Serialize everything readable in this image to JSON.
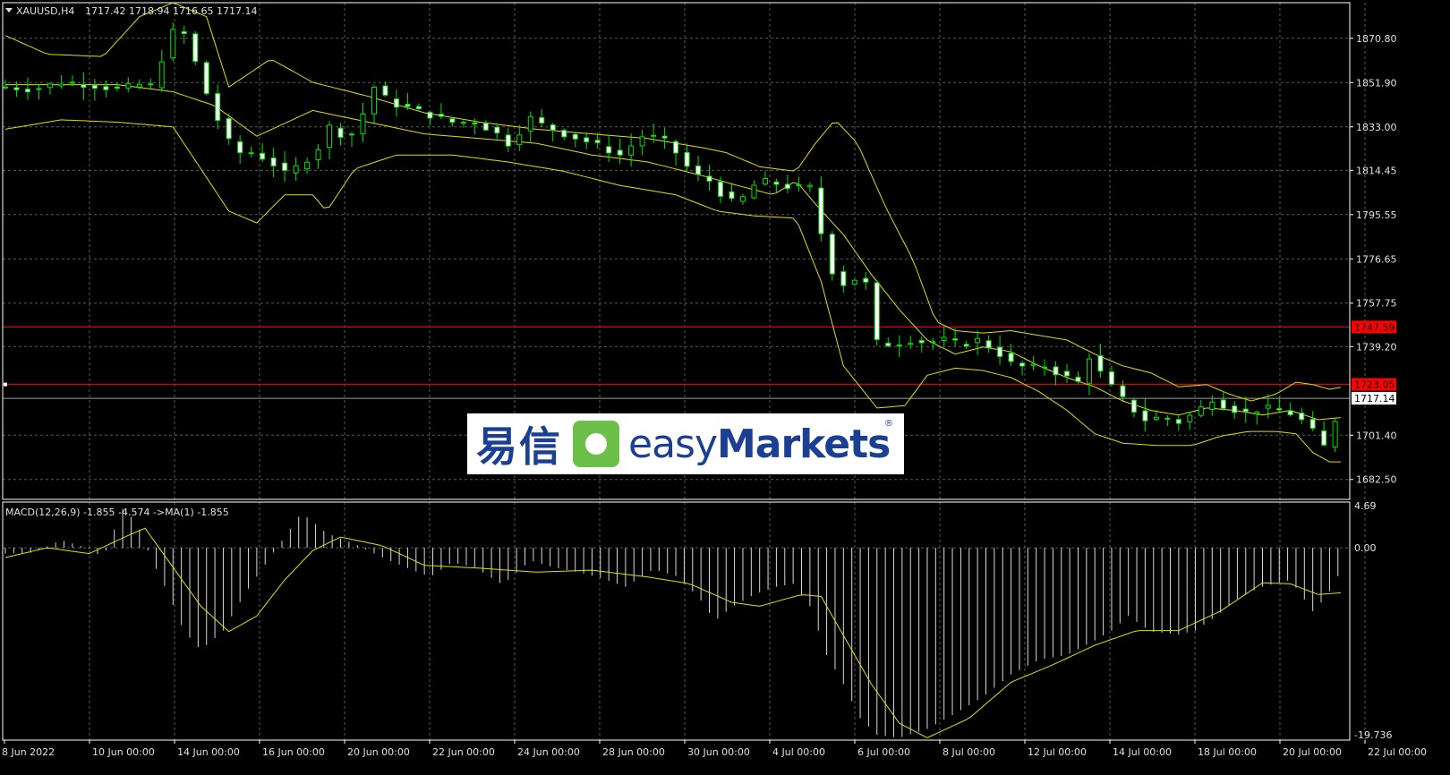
{
  "header": {
    "symbol": "XAUUSD,H4",
    "ohlc": "1717.42 1718.94 1716.65 1717.14"
  },
  "macd_label": "MACD(12,26,9) -1.855 -4.574  ->MA(1) -1.855",
  "logo": {
    "cn": "易信",
    "en_light": "easy",
    "en_bold": "Markets",
    "reg": "®"
  },
  "colors": {
    "bg": "#000000",
    "grid": "#5a5a5a",
    "candle": "#00e000",
    "band": "#e0e000",
    "macd_hist": "#d8d8d8",
    "signal": "#e0e000",
    "hline": "#ff0000",
    "price_line": "#a0a0a0"
  },
  "chart_data": [
    {
      "type": "candlestick",
      "title": "XAUUSD,H4",
      "ylim": [
        1674.0,
        1886.0
      ],
      "y_ticks": [
        1870.8,
        1851.9,
        1833.0,
        1814.45,
        1795.55,
        1776.65,
        1757.75,
        1739.2,
        1701.4,
        1682.5
      ],
      "x_ticks": [
        "8 Jun 2022",
        "10 Jun 00:00",
        "14 Jun 00:00",
        "16 Jun 00:00",
        "20 Jun 00:00",
        "22 Jun 00:00",
        "24 Jun 00:00",
        "28 Jun 00:00",
        "30 Jun 00:00",
        "4 Jul 00:00",
        "6 Jul 00:00",
        "8 Jul 00:00",
        "12 Jul 00:00",
        "14 Jul 00:00",
        "18 Jul 00:00",
        "20 Jul 00:00",
        "22 Jul 00:00"
      ],
      "hlines": [
        {
          "value": 1747.59,
          "label": "1747.59"
        },
        {
          "value": 1723.05,
          "label": "1723.05"
        }
      ],
      "current_price": {
        "value": 1717.14,
        "label": "1717.14"
      },
      "close_path": [
        [
          0,
          1850
        ],
        [
          10,
          1849
        ],
        [
          20,
          1852
        ],
        [
          30,
          1851
        ],
        [
          40,
          1849
        ],
        [
          48,
          1851
        ],
        [
          53,
          1850
        ],
        [
          58,
          1870
        ],
        [
          62,
          1877
        ],
        [
          66,
          1868
        ],
        [
          70,
          1853
        ],
        [
          76,
          1836
        ],
        [
          82,
          1822
        ],
        [
          88,
          1822
        ],
        [
          94,
          1819
        ],
        [
          100,
          1813
        ],
        [
          106,
          1817
        ],
        [
          112,
          1824
        ],
        [
          116,
          1833
        ],
        [
          120,
          1830
        ],
        [
          125,
          1830
        ],
        [
          132,
          1850
        ],
        [
          138,
          1843
        ],
        [
          145,
          1841
        ],
        [
          152,
          1838
        ],
        [
          160,
          1835
        ],
        [
          168,
          1835
        ],
        [
          175,
          1831
        ],
        [
          182,
          1824
        ],
        [
          186,
          1838
        ],
        [
          192,
          1834
        ],
        [
          200,
          1830
        ],
        [
          210,
          1826
        ],
        [
          220,
          1821
        ],
        [
          228,
          1829
        ],
        [
          235,
          1828
        ],
        [
          240,
          1822
        ],
        [
          246,
          1813
        ],
        [
          252,
          1810
        ],
        [
          258,
          1802
        ],
        [
          262,
          1800
        ],
        [
          268,
          1808
        ],
        [
          273,
          1810
        ],
        [
          278,
          1808
        ],
        [
          282,
          1807
        ],
        [
          288,
          1807
        ],
        [
          294,
          1778
        ],
        [
          298,
          1765
        ],
        [
          304,
          1768
        ],
        [
          308,
          1766
        ],
        [
          312,
          1741
        ],
        [
          318,
          1740
        ],
        [
          324,
          1742
        ],
        [
          330,
          1741
        ],
        [
          336,
          1742
        ],
        [
          342,
          1740
        ],
        [
          348,
          1742
        ],
        [
          354,
          1738
        ],
        [
          360,
          1732
        ],
        [
          366,
          1730
        ],
        [
          372,
          1731
        ],
        [
          378,
          1727
        ],
        [
          384,
          1724
        ],
        [
          388,
          1735
        ],
        [
          392,
          1728
        ],
        [
          396,
          1722
        ],
        [
          402,
          1714
        ],
        [
          408,
          1708
        ],
        [
          414,
          1709
        ],
        [
          420,
          1707
        ],
        [
          426,
          1711
        ],
        [
          432,
          1717
        ],
        [
          438,
          1713
        ],
        [
          444,
          1711
        ],
        [
          450,
          1713
        ],
        [
          456,
          1712
        ],
        [
          462,
          1710
        ],
        [
          468,
          1703
        ],
        [
          473,
          1695
        ],
        [
          476,
          1708
        ],
        [
          479,
          1717
        ]
      ],
      "upper_band_path": [
        [
          0,
          1872
        ],
        [
          15,
          1864
        ],
        [
          35,
          1863
        ],
        [
          48,
          1880
        ],
        [
          60,
          1886
        ],
        [
          72,
          1880
        ],
        [
          80,
          1850
        ],
        [
          95,
          1862
        ],
        [
          110,
          1852
        ],
        [
          130,
          1846
        ],
        [
          150,
          1839
        ],
        [
          170,
          1835
        ],
        [
          190,
          1832
        ],
        [
          210,
          1830
        ],
        [
          230,
          1828
        ],
        [
          250,
          1824
        ],
        [
          258,
          1822
        ],
        [
          270,
          1816
        ],
        [
          283,
          1814
        ],
        [
          290,
          1826
        ],
        [
          297,
          1836
        ],
        [
          305,
          1826
        ],
        [
          315,
          1799
        ],
        [
          325,
          1776
        ],
        [
          333,
          1750
        ],
        [
          340,
          1746
        ],
        [
          350,
          1745
        ],
        [
          360,
          1746
        ],
        [
          370,
          1744
        ],
        [
          380,
          1742
        ],
        [
          390,
          1736
        ],
        [
          400,
          1731
        ],
        [
          410,
          1728
        ],
        [
          420,
          1722
        ],
        [
          430,
          1723
        ],
        [
          438,
          1719
        ],
        [
          446,
          1716
        ],
        [
          455,
          1719
        ],
        [
          462,
          1724
        ],
        [
          468,
          1723
        ],
        [
          474,
          1721
        ],
        [
          479,
          1722
        ]
      ],
      "middle_band_path": [
        [
          0,
          1851
        ],
        [
          20,
          1851
        ],
        [
          40,
          1851
        ],
        [
          60,
          1848
        ],
        [
          75,
          1842
        ],
        [
          90,
          1829
        ],
        [
          110,
          1840
        ],
        [
          130,
          1835
        ],
        [
          150,
          1830
        ],
        [
          170,
          1828
        ],
        [
          190,
          1826
        ],
        [
          210,
          1821
        ],
        [
          230,
          1818
        ],
        [
          250,
          1812
        ],
        [
          262,
          1808
        ],
        [
          275,
          1804
        ],
        [
          283,
          1810
        ],
        [
          290,
          1800
        ],
        [
          300,
          1787
        ],
        [
          310,
          1770
        ],
        [
          320,
          1755
        ],
        [
          330,
          1742
        ],
        [
          340,
          1736
        ],
        [
          350,
          1739
        ],
        [
          360,
          1737
        ],
        [
          370,
          1731
        ],
        [
          380,
          1726
        ],
        [
          390,
          1722
        ],
        [
          400,
          1716
        ],
        [
          410,
          1712
        ],
        [
          420,
          1710
        ],
        [
          430,
          1713
        ],
        [
          440,
          1712
        ],
        [
          450,
          1710
        ],
        [
          460,
          1712
        ],
        [
          470,
          1708
        ],
        [
          479,
          1709
        ]
      ],
      "lower_band_path": [
        [
          0,
          1832
        ],
        [
          20,
          1836
        ],
        [
          40,
          1835
        ],
        [
          60,
          1833
        ],
        [
          70,
          1815
        ],
        [
          80,
          1797
        ],
        [
          90,
          1792
        ],
        [
          100,
          1804
        ],
        [
          110,
          1804
        ],
        [
          115,
          1797
        ],
        [
          125,
          1815
        ],
        [
          140,
          1821
        ],
        [
          160,
          1821
        ],
        [
          180,
          1818
        ],
        [
          200,
          1814
        ],
        [
          220,
          1808
        ],
        [
          240,
          1804
        ],
        [
          255,
          1797
        ],
        [
          268,
          1795
        ],
        [
          283,
          1794
        ],
        [
          292,
          1767
        ],
        [
          300,
          1731
        ],
        [
          312,
          1713
        ],
        [
          322,
          1714
        ],
        [
          330,
          1727
        ],
        [
          340,
          1730
        ],
        [
          350,
          1729
        ],
        [
          360,
          1726
        ],
        [
          370,
          1720
        ],
        [
          380,
          1712
        ],
        [
          390,
          1702
        ],
        [
          400,
          1698
        ],
        [
          412,
          1697
        ],
        [
          425,
          1697
        ],
        [
          435,
          1701
        ],
        [
          445,
          1703
        ],
        [
          455,
          1703
        ],
        [
          462,
          1702
        ],
        [
          468,
          1694
        ],
        [
          474,
          1690
        ],
        [
          479,
          1690
        ]
      ]
    },
    {
      "type": "bar",
      "title": "MACD(12,26,9) -1.855 -4.574  ->MA(1) -1.855",
      "ylim": [
        -19.736,
        4.69
      ],
      "y_ticks": [
        4.69,
        0.0,
        -19.736
      ],
      "y_tick_labels": [
        "4.69",
        "0.00",
        "-19.736"
      ],
      "macd_path": [
        [
          0,
          -0.6
        ],
        [
          10,
          -0.5
        ],
        [
          20,
          0.8
        ],
        [
          30,
          -0.1
        ],
        [
          35,
          -1.0
        ],
        [
          42,
          4.0
        ],
        [
          47,
          2.6
        ],
        [
          52,
          -1.0
        ],
        [
          58,
          -4.5
        ],
        [
          64,
          -8.6
        ],
        [
          70,
          -10.5
        ],
        [
          78,
          -8.5
        ],
        [
          86,
          -4.6
        ],
        [
          96,
          -0.5
        ],
        [
          106,
          3.6
        ],
        [
          115,
          1.5
        ],
        [
          125,
          0.4
        ],
        [
          135,
          -1.0
        ],
        [
          145,
          -2.2
        ],
        [
          152,
          -3.0
        ],
        [
          160,
          -1.5
        ],
        [
          168,
          -2.0
        ],
        [
          178,
          -3.8
        ],
        [
          188,
          -1.3
        ],
        [
          196,
          -2.0
        ],
        [
          205,
          -2.5
        ],
        [
          212,
          -3.0
        ],
        [
          222,
          -4.0
        ],
        [
          232,
          -2.2
        ],
        [
          240,
          -2.9
        ],
        [
          248,
          -5.0
        ],
        [
          254,
          -7.5
        ],
        [
          260,
          -6.1
        ],
        [
          268,
          -4.8
        ],
        [
          276,
          -4.0
        ],
        [
          282,
          -3.7
        ],
        [
          288,
          -6.0
        ],
        [
          294,
          -11.0
        ],
        [
          300,
          -14.0
        ],
        [
          306,
          -17.5
        ],
        [
          312,
          -19.2
        ],
        [
          320,
          -19.5
        ],
        [
          330,
          -18.6
        ],
        [
          340,
          -17.0
        ],
        [
          350,
          -15.3
        ],
        [
          360,
          -13.0
        ],
        [
          370,
          -11.5
        ],
        [
          380,
          -11.0
        ],
        [
          390,
          -9.5
        ],
        [
          396,
          -8.5
        ],
        [
          402,
          -7.0
        ],
        [
          410,
          -8.6
        ],
        [
          420,
          -8.9
        ],
        [
          426,
          -8.5
        ],
        [
          434,
          -6.9
        ],
        [
          442,
          -5.0
        ],
        [
          450,
          -4.0
        ],
        [
          460,
          -3.3
        ],
        [
          468,
          -6.5
        ],
        [
          473,
          -5.0
        ],
        [
          479,
          -1.9
        ]
      ],
      "signal_path": [
        [
          0,
          -1.0
        ],
        [
          15,
          0.0
        ],
        [
          30,
          -0.6
        ],
        [
          45,
          1.4
        ],
        [
          50,
          2.0
        ],
        [
          60,
          -2.0
        ],
        [
          70,
          -6.0
        ],
        [
          80,
          -8.6
        ],
        [
          90,
          -7.0
        ],
        [
          100,
          -3.3
        ],
        [
          110,
          -0.3
        ],
        [
          120,
          1.1
        ],
        [
          135,
          0.2
        ],
        [
          150,
          -1.8
        ],
        [
          170,
          -2.1
        ],
        [
          190,
          -2.5
        ],
        [
          210,
          -2.3
        ],
        [
          230,
          -3.0
        ],
        [
          245,
          -3.7
        ],
        [
          260,
          -5.6
        ],
        [
          270,
          -6.0
        ],
        [
          285,
          -4.8
        ],
        [
          292,
          -5.0
        ],
        [
          300,
          -9.0
        ],
        [
          310,
          -14.0
        ],
        [
          320,
          -18.0
        ],
        [
          330,
          -19.5
        ],
        [
          345,
          -17.5
        ],
        [
          360,
          -13.8
        ],
        [
          375,
          -12.0
        ],
        [
          390,
          -10.0
        ],
        [
          405,
          -8.5
        ],
        [
          420,
          -8.5
        ],
        [
          435,
          -6.5
        ],
        [
          450,
          -3.6
        ],
        [
          460,
          -3.7
        ],
        [
          470,
          -4.8
        ],
        [
          479,
          -4.6
        ]
      ]
    }
  ]
}
